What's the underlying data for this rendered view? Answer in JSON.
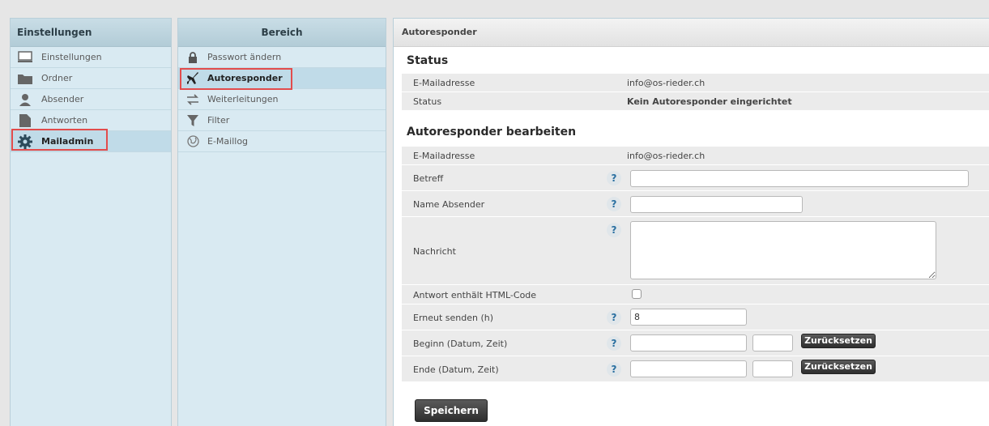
{
  "panel_settings": {
    "title": "Einstellungen",
    "items": [
      {
        "label": "Einstellungen",
        "icon": "monitor-icon"
      },
      {
        "label": "Ordner",
        "icon": "folder-icon"
      },
      {
        "label": "Absender",
        "icon": "user-icon"
      },
      {
        "label": "Antworten",
        "icon": "document-icon"
      },
      {
        "label": "Mailadmin",
        "icon": "gear-icon",
        "active": true
      }
    ]
  },
  "panel_area": {
    "title": "Bereich",
    "items": [
      {
        "label": "Passwort ändern",
        "icon": "lock-icon"
      },
      {
        "label": "Autoresponder",
        "icon": "airplane-icon",
        "active": true
      },
      {
        "label": "Weiterleitungen",
        "icon": "arrows-icon"
      },
      {
        "label": "Filter",
        "icon": "funnel-icon"
      },
      {
        "label": "E-Maillog",
        "icon": "globe-icon"
      }
    ]
  },
  "main": {
    "title": "Autoresponder",
    "status": {
      "heading": "Status",
      "email_label": "E-Mailadresse",
      "email_value": "info@os-rieder.ch",
      "status_label": "Status",
      "status_value": "Kein Autoresponder eingerichtet"
    },
    "edit": {
      "heading": "Autoresponder bearbeiten",
      "email_label": "E-Mailadresse",
      "email_value": "info@os-rieder.ch",
      "subject_label": "Betreff",
      "subject_value": "",
      "sender_label": "Name Absender",
      "sender_value": "",
      "message_label": "Nachricht",
      "message_value": "",
      "html_label": "Antwort enthält HTML-Code",
      "html_checked": false,
      "resend_label": "Erneut senden (h)",
      "resend_value": "8",
      "start_label": "Beginn (Datum, Zeit)",
      "end_label": "Ende (Datum, Zeit)",
      "reset_label": "Zurücksetzen",
      "help_symbol": "?",
      "save_label": "Speichern"
    }
  }
}
